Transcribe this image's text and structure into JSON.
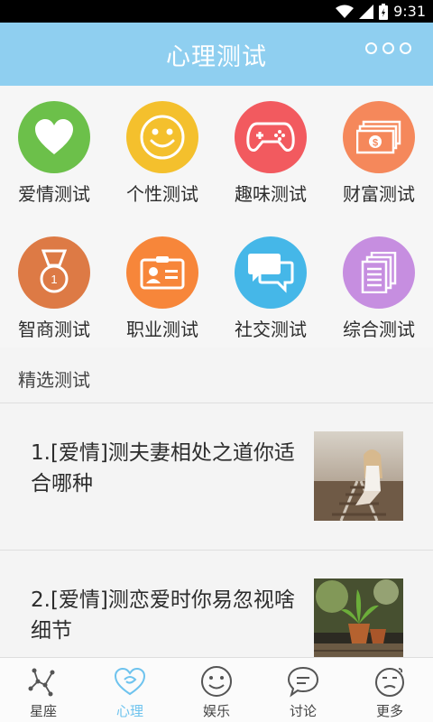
{
  "status_bar": {
    "time": "9:31"
  },
  "header": {
    "title": "心理测试",
    "more_icon": "more-dots-icon"
  },
  "categories": [
    {
      "label": "爱情测试",
      "icon": "heart-icon",
      "color": "#6cc04a"
    },
    {
      "label": "个性测试",
      "icon": "smiley-icon",
      "color": "#f4c02d"
    },
    {
      "label": "趣味测试",
      "icon": "gamepad-icon",
      "color": "#f25a5f"
    },
    {
      "label": "财富测试",
      "icon": "money-icon",
      "color": "#f5885b"
    },
    {
      "label": "智商测试",
      "icon": "medal-icon",
      "color": "#dd7a45"
    },
    {
      "label": "职业测试",
      "icon": "id-card-icon",
      "color": "#f7863a"
    },
    {
      "label": "社交测试",
      "icon": "chat-icon",
      "color": "#45b7e8"
    },
    {
      "label": "综合测试",
      "icon": "documents-icon",
      "color": "#c68ee0"
    }
  ],
  "featured": {
    "title": "精选测试",
    "articles": [
      {
        "text": "1.[爱情]测夫妻相处之道你适合哪种",
        "thumb": "girl-on-railway-photo"
      },
      {
        "text": "2.[爱情]测恋爱时你易忽视啥细节",
        "thumb": "potted-plants-photo"
      }
    ]
  },
  "tabs": [
    {
      "label": "星座",
      "icon": "constellation-icon",
      "active": false
    },
    {
      "label": "心理",
      "icon": "heart-swirl-icon",
      "active": true
    },
    {
      "label": "娱乐",
      "icon": "smile-face-icon",
      "active": false
    },
    {
      "label": "讨论",
      "icon": "chat-bubble-icon",
      "active": false
    },
    {
      "label": "更多",
      "icon": "more-face-icon",
      "active": false
    }
  ],
  "colors": {
    "accent": "#8fcff0",
    "active_tab": "#6ec3ee"
  }
}
